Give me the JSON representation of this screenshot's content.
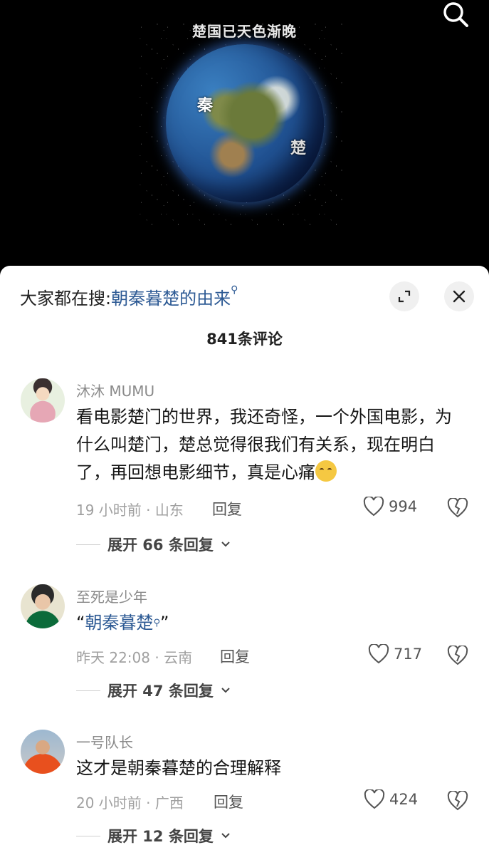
{
  "video": {
    "title_overlay": "楚国已天色渐晚",
    "map_labels": {
      "qin": "秦",
      "chu": "楚"
    },
    "search_icon": "search-icon"
  },
  "panel": {
    "hot_search_prefix": "大家都在搜:",
    "hot_search_keyword": "朝秦暮楚的由来",
    "comment_count": "841条评论",
    "expand_icon": "expand-icon",
    "close_icon": "close-icon"
  },
  "comments": [
    {
      "username": "沐沐 MUMU",
      "text": "看电影楚门的世界，我还奇怪，一个外国电影，为什么叫楚门，楚总觉得很我们有关系，现在明白了，再回想电影细节，真是心痛",
      "emoji": "crying-emoji",
      "meta": "19 小时前 · 山东",
      "reply_label": "回复",
      "likes": "994",
      "expand_label": "展开 66 条回复"
    },
    {
      "username": "至死是少年",
      "text_prefix": "“",
      "text_keyword": "朝秦暮楚",
      "text_suffix": "”",
      "meta": "昨天 22:08 · 云南",
      "reply_label": "回复",
      "likes": "717",
      "expand_label": "展开 47 条回复"
    },
    {
      "username": "一号队长",
      "text": "这才是朝秦暮楚的合理解释",
      "meta": "20 小时前 · 广西",
      "reply_label": "回复",
      "likes": "424",
      "expand_label": "展开 12 条回复"
    }
  ],
  "colors": {
    "keyword_blue": "#2d5a94",
    "panel_bg": "#ffffff",
    "video_bg": "#000000"
  }
}
